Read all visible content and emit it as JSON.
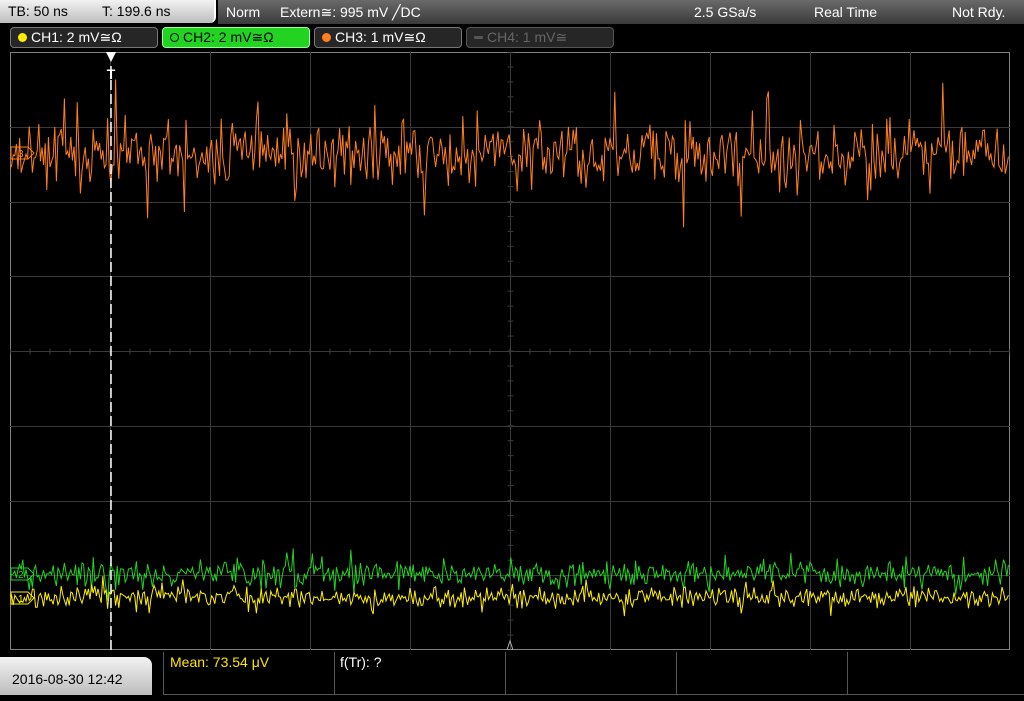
{
  "topbar": {
    "timebase": "TB: 50 ns",
    "trigger_time": "T: 199.6 ns",
    "mode": "Norm",
    "trigger": "Extern≅: 995 mV ╱DC",
    "sample_rate": "2.5 GSa/s",
    "acq_mode": "Real Time",
    "status": "Not Rdy."
  },
  "channels": [
    {
      "label": "CH1: 2 mV≅Ω",
      "color": "#ffee00"
    },
    {
      "label": "CH2: 2 mV≅Ω",
      "color": "#22d322"
    },
    {
      "label": "CH3: 1 mV≅Ω",
      "color": "#ff7f1e"
    },
    {
      "label": "CH4: 1 mV≅",
      "color": "#555555"
    }
  ],
  "markers": {
    "trigger": "T",
    "ch1": "1",
    "ch2": "2",
    "ch3": "3"
  },
  "measurements": {
    "mean": "Mean: 73.54 μV",
    "ftr": "f(Tr): ?"
  },
  "datetime": "2016-08-30 12:42",
  "colors": {
    "grid": "#3a3a3a",
    "ch1": "#ffee00",
    "ch2": "#22d322",
    "ch3": "#ff7f1e",
    "trigger_line": "#ffffff"
  }
}
